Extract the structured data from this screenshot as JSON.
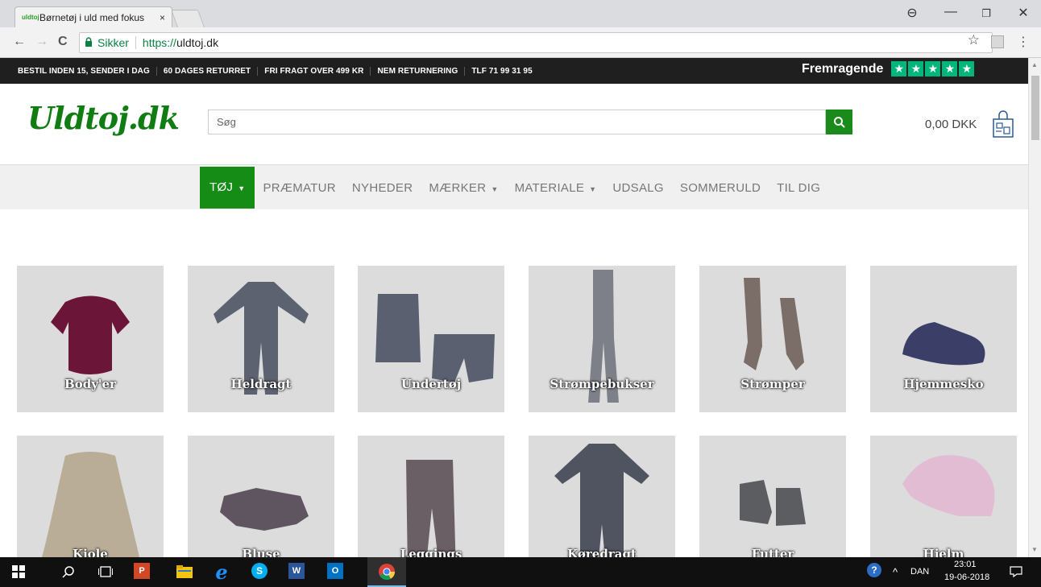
{
  "browser": {
    "tab_title": "Børnetøj i uld med fokus",
    "tab_close": "×",
    "secure_label": "Sikker",
    "url_proto": "https://",
    "url_host": "uldtoj.dk",
    "back_icon": "←",
    "forward_icon": "→",
    "reload_icon": "C",
    "star_icon": "☆",
    "menu_icon": "⋮",
    "profile_icon": "⊖",
    "minimize_icon": "—",
    "restore_icon": "❐",
    "close_icon": "✕"
  },
  "topbar": {
    "items": [
      "BESTIL INDEN 15, SENDER I DAG",
      "60 DAGES RETURRET",
      "FRI FRAGT OVER 499 KR",
      "NEM RETURNERING",
      "TLF 71 99 31 95"
    ],
    "trust_label": "Fremragende",
    "trust_stars": 5
  },
  "header": {
    "logo": "Uldtoj.dk",
    "search_placeholder": "Søg",
    "cart_total": "0,00 DKK"
  },
  "nav": {
    "items": [
      {
        "label": "TØJ",
        "caret": true,
        "active": true
      },
      {
        "label": "PRÆMATUR",
        "caret": false
      },
      {
        "label": "NYHEDER",
        "caret": false
      },
      {
        "label": "MÆRKER",
        "caret": true
      },
      {
        "label": "MATERIALE",
        "caret": true
      },
      {
        "label": "UDSALG",
        "caret": false
      },
      {
        "label": "SOMMERULD",
        "caret": false
      },
      {
        "label": "TIL DIG",
        "caret": false
      }
    ]
  },
  "categories": [
    {
      "label": "Body'er",
      "color": "#6b1538"
    },
    {
      "label": "Heldragt",
      "color": "#5d6270"
    },
    {
      "label": "Undertøj",
      "color": "#5b6070"
    },
    {
      "label": "Strømpebukser",
      "color": "#7d8088"
    },
    {
      "label": "Strømper",
      "color": "#7b6e68"
    },
    {
      "label": "Hjemmesko",
      "color": "#3b3f68"
    },
    {
      "label": "Kjole",
      "color": "#b9ad97"
    },
    {
      "label": "Bluse",
      "color": "#5f5560"
    },
    {
      "label": "Leggings",
      "color": "#6b5f66"
    },
    {
      "label": "Køredragt",
      "color": "#4f5460"
    },
    {
      "label": "Futter",
      "color": "#5b5d61"
    },
    {
      "label": "Hjelm",
      "color": "#e2bcd2"
    }
  ],
  "taskbar": {
    "language": "DAN",
    "time": "23:01",
    "date": "19-06-2018"
  }
}
